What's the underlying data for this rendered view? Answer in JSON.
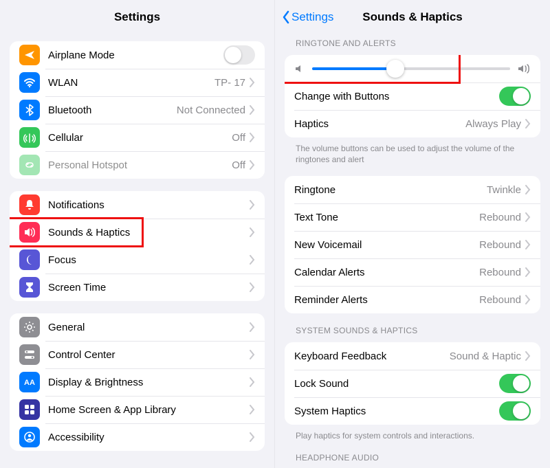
{
  "left": {
    "title": "Settings",
    "g1": [
      {
        "key": "airplane",
        "label": "Airplane Mode",
        "iconBg": "#ff9500",
        "iconName": "airplane-icon",
        "type": "toggle",
        "on": false
      },
      {
        "key": "wlan",
        "label": "WLAN",
        "iconBg": "#007aff",
        "iconName": "wifi-icon",
        "type": "nav",
        "value": "TP- 17"
      },
      {
        "key": "bluetooth",
        "label": "Bluetooth",
        "iconBg": "#007aff",
        "iconName": "bluetooth-icon",
        "type": "nav",
        "value": "Not Connected"
      },
      {
        "key": "cellular",
        "label": "Cellular",
        "iconBg": "#34c759",
        "iconName": "antenna-icon",
        "type": "nav",
        "value": "Off"
      },
      {
        "key": "hotspot",
        "label": "Personal Hotspot",
        "iconBg": "#34c759",
        "iconName": "link-icon",
        "type": "nav",
        "value": "Off",
        "dimmed": true
      }
    ],
    "g2": [
      {
        "key": "notifications",
        "label": "Notifications",
        "iconBg": "#ff3b30",
        "iconName": "bell-icon",
        "type": "nav"
      },
      {
        "key": "sounds",
        "label": "Sounds & Haptics",
        "iconBg": "#ff2d55",
        "iconName": "speaker-icon",
        "type": "nav",
        "highlight": true
      },
      {
        "key": "focus",
        "label": "Focus",
        "iconBg": "#5856d6",
        "iconName": "moon-icon",
        "type": "nav"
      },
      {
        "key": "screentime",
        "label": "Screen Time",
        "iconBg": "#5856d6",
        "iconName": "hourglass-icon",
        "type": "nav"
      }
    ],
    "g3": [
      {
        "key": "general",
        "label": "General",
        "iconBg": "#8e8e93",
        "iconName": "gear-icon",
        "type": "nav"
      },
      {
        "key": "controlcenter",
        "label": "Control Center",
        "iconBg": "#8e8e93",
        "iconName": "switches-icon",
        "type": "nav"
      },
      {
        "key": "display",
        "label": "Display & Brightness",
        "iconBg": "#007aff",
        "iconName": "sun-icon",
        "type": "nav"
      },
      {
        "key": "home",
        "label": "Home Screen & App Library",
        "iconBg": "#3634a3",
        "iconName": "grid-icon",
        "type": "nav"
      },
      {
        "key": "accessibility",
        "label": "Accessibility",
        "iconBg": "#007aff",
        "iconName": "person-icon",
        "type": "nav"
      }
    ]
  },
  "right": {
    "backLabel": "Settings",
    "title": "Sounds & Haptics",
    "sectionRingtone": "RINGTONE AND ALERTS",
    "sliderPercent": 42,
    "changeButtons": {
      "label": "Change with Buttons",
      "on": true
    },
    "haptics": {
      "label": "Haptics",
      "value": "Always Play"
    },
    "ringtoneFooter": "The volume buttons can be used to adjust the volume of the ringtones and alert",
    "tones": [
      {
        "key": "ringtone",
        "label": "Ringtone",
        "value": "Twinkle"
      },
      {
        "key": "texttone",
        "label": "Text Tone",
        "value": "Rebound"
      },
      {
        "key": "voicemail",
        "label": "New Voicemail",
        "value": "Rebound"
      },
      {
        "key": "calendar",
        "label": "Calendar Alerts",
        "value": "Rebound"
      },
      {
        "key": "reminder",
        "label": "Reminder Alerts",
        "value": "Rebound"
      }
    ],
    "sectionSystem": "SYSTEM SOUNDS & HAPTICS",
    "keyboard": {
      "label": "Keyboard Feedback",
      "value": "Sound & Haptic"
    },
    "lockSound": {
      "label": "Lock Sound",
      "on": true
    },
    "systemHaptics": {
      "label": "System Haptics",
      "on": true
    },
    "systemFooter": "Play haptics for system controls and interactions.",
    "sectionHeadphone": "HEADPHONE AUDIO"
  }
}
